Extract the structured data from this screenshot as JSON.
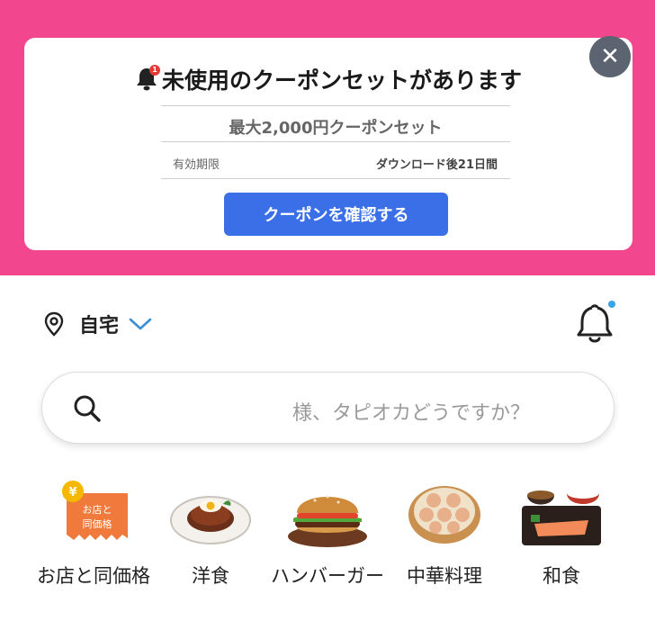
{
  "banner": {
    "title": "未使用のクーポンセットがあります",
    "bell_badge": "1",
    "coupon_name": "最大2,000円クーポンセット",
    "expiry_label": "有効期限",
    "expiry_value": "ダウンロード後21日間",
    "confirm_button": "クーポンを確認する",
    "close_label": "✕",
    "colors": {
      "background": "#f2478f",
      "button": "#3a6fe8"
    }
  },
  "location": {
    "label": "自宅"
  },
  "search": {
    "placeholder": "様、タピオカどうですか？"
  },
  "categories": [
    {
      "label": "お店と同価格",
      "icon": "same-price-tag",
      "badge_text": "お店と同価格",
      "yen": "¥"
    },
    {
      "label": "洋食",
      "icon": "hamburg-steak-plate"
    },
    {
      "label": "ハンバーガー",
      "icon": "burger"
    },
    {
      "label": "中華料理",
      "icon": "dim-sum-steamer"
    },
    {
      "label": "和食",
      "icon": "japanese-set-meal"
    }
  ]
}
